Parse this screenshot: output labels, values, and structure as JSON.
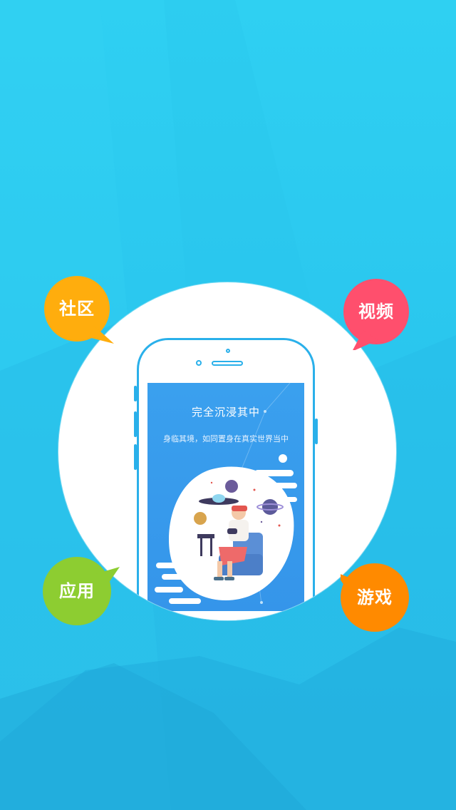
{
  "bubbles": {
    "community": {
      "label": "社区",
      "color": "#ffad0d"
    },
    "video": {
      "label": "视频",
      "color": "#ff4f6d"
    },
    "apps": {
      "label": "应用",
      "color": "#8dcd31"
    },
    "games": {
      "label": "游戏",
      "color": "#ff8a00"
    }
  },
  "phone_screen": {
    "title": "完全沉浸其中",
    "subtitle": "身临其境，如同置身在真实世界当中"
  },
  "colors": {
    "background": "#2ac6ee",
    "phone_outline": "#2ab0ea",
    "phone_screen": "#3a9cee"
  }
}
